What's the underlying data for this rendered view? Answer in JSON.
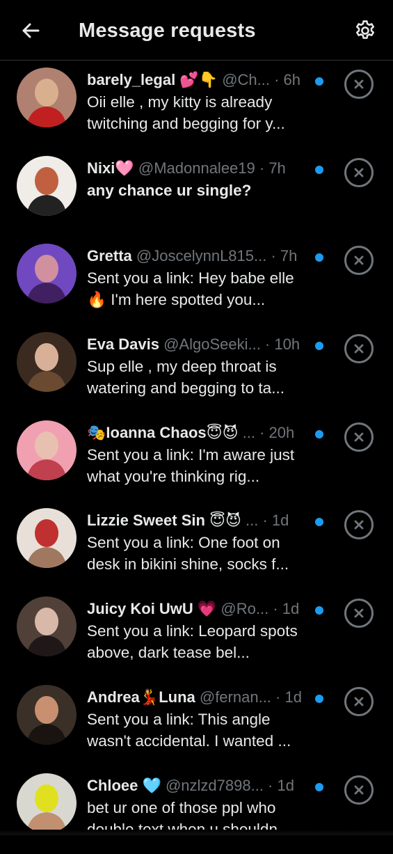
{
  "header": {
    "title": "Message requests",
    "back_icon": "arrow-left-icon",
    "settings_icon": "gear-icon"
  },
  "colors": {
    "background": "#000000",
    "text": "#e7e9ea",
    "muted": "#71767b",
    "unread": "#1d9bf0"
  },
  "requests": [
    {
      "name": "barely_legal 💕👇",
      "handle_time": " @Ch... · 6h",
      "preview": "Oii elle  , my kitty is already twitching and begging for y...",
      "bold": false,
      "avatar_colors": [
        "#b08070",
        "#d8b090",
        "#c02020"
      ]
    },
    {
      "name": "Nixi🩷",
      "handle_time": " @Madonnalee19 · 7h",
      "preview": "any chance ur single?",
      "bold": true,
      "avatar_colors": [
        "#f0ece8",
        "#c06040",
        "#222222"
      ]
    },
    {
      "name": "Gretta",
      "handle_time": " @JoscelynnL815... · 7h",
      "preview": "Sent you a link: Hey babe elle 🔥 I'm here spotted you...",
      "bold": false,
      "avatar_colors": [
        "#7048c0",
        "#d090a0",
        "#402060"
      ]
    },
    {
      "name": "Eva Davis",
      "handle_time": " @AlgoSeeki... · 10h",
      "preview": "Sup elle  , my deep throat is watering and begging to ta...",
      "bold": false,
      "avatar_colors": [
        "#3a2a20",
        "#d8b098",
        "#6a4a30"
      ]
    },
    {
      "name": "🎭Ioanna Chaos😇😈",
      "handle_time": " ... · 20h",
      "preview": "Sent you a link: I'm aware just what you're thinking rig...",
      "bold": false,
      "avatar_colors": [
        "#f0a0b0",
        "#e8c0b0",
        "#c04050"
      ]
    },
    {
      "name": "Lizzie Sweet Sin 😇😈",
      "handle_time": " ... · 1d",
      "preview": "Sent you a link: One foot on desk in bikini shine, socks f...",
      "bold": false,
      "avatar_colors": [
        "#e8e0d8",
        "#c03030",
        "#a07860"
      ]
    },
    {
      "name": "Juicy Koi UwU 💗",
      "handle_time": " @Ro... · 1d",
      "preview": "Sent you a link: Leopard spots above, dark tease bel...",
      "bold": false,
      "avatar_colors": [
        "#504038",
        "#d8b8a8",
        "#201818"
      ]
    },
    {
      "name": "Andrea💃Luna",
      "handle_time": " @fernan... · 1d",
      "preview": "Sent you a link: This angle wasn't accidental. I wanted ...",
      "bold": false,
      "avatar_colors": [
        "#3a3028",
        "#c89070",
        "#1a1410"
      ]
    },
    {
      "name": "Chloee 🩵",
      "handle_time": " @nzlzd7898... · 1d",
      "preview": "bet ur one of those ppl who double text when u shouldn...",
      "bold": false,
      "avatar_colors": [
        "#d8d8d0",
        "#e0e020",
        "#c09070"
      ]
    }
  ]
}
